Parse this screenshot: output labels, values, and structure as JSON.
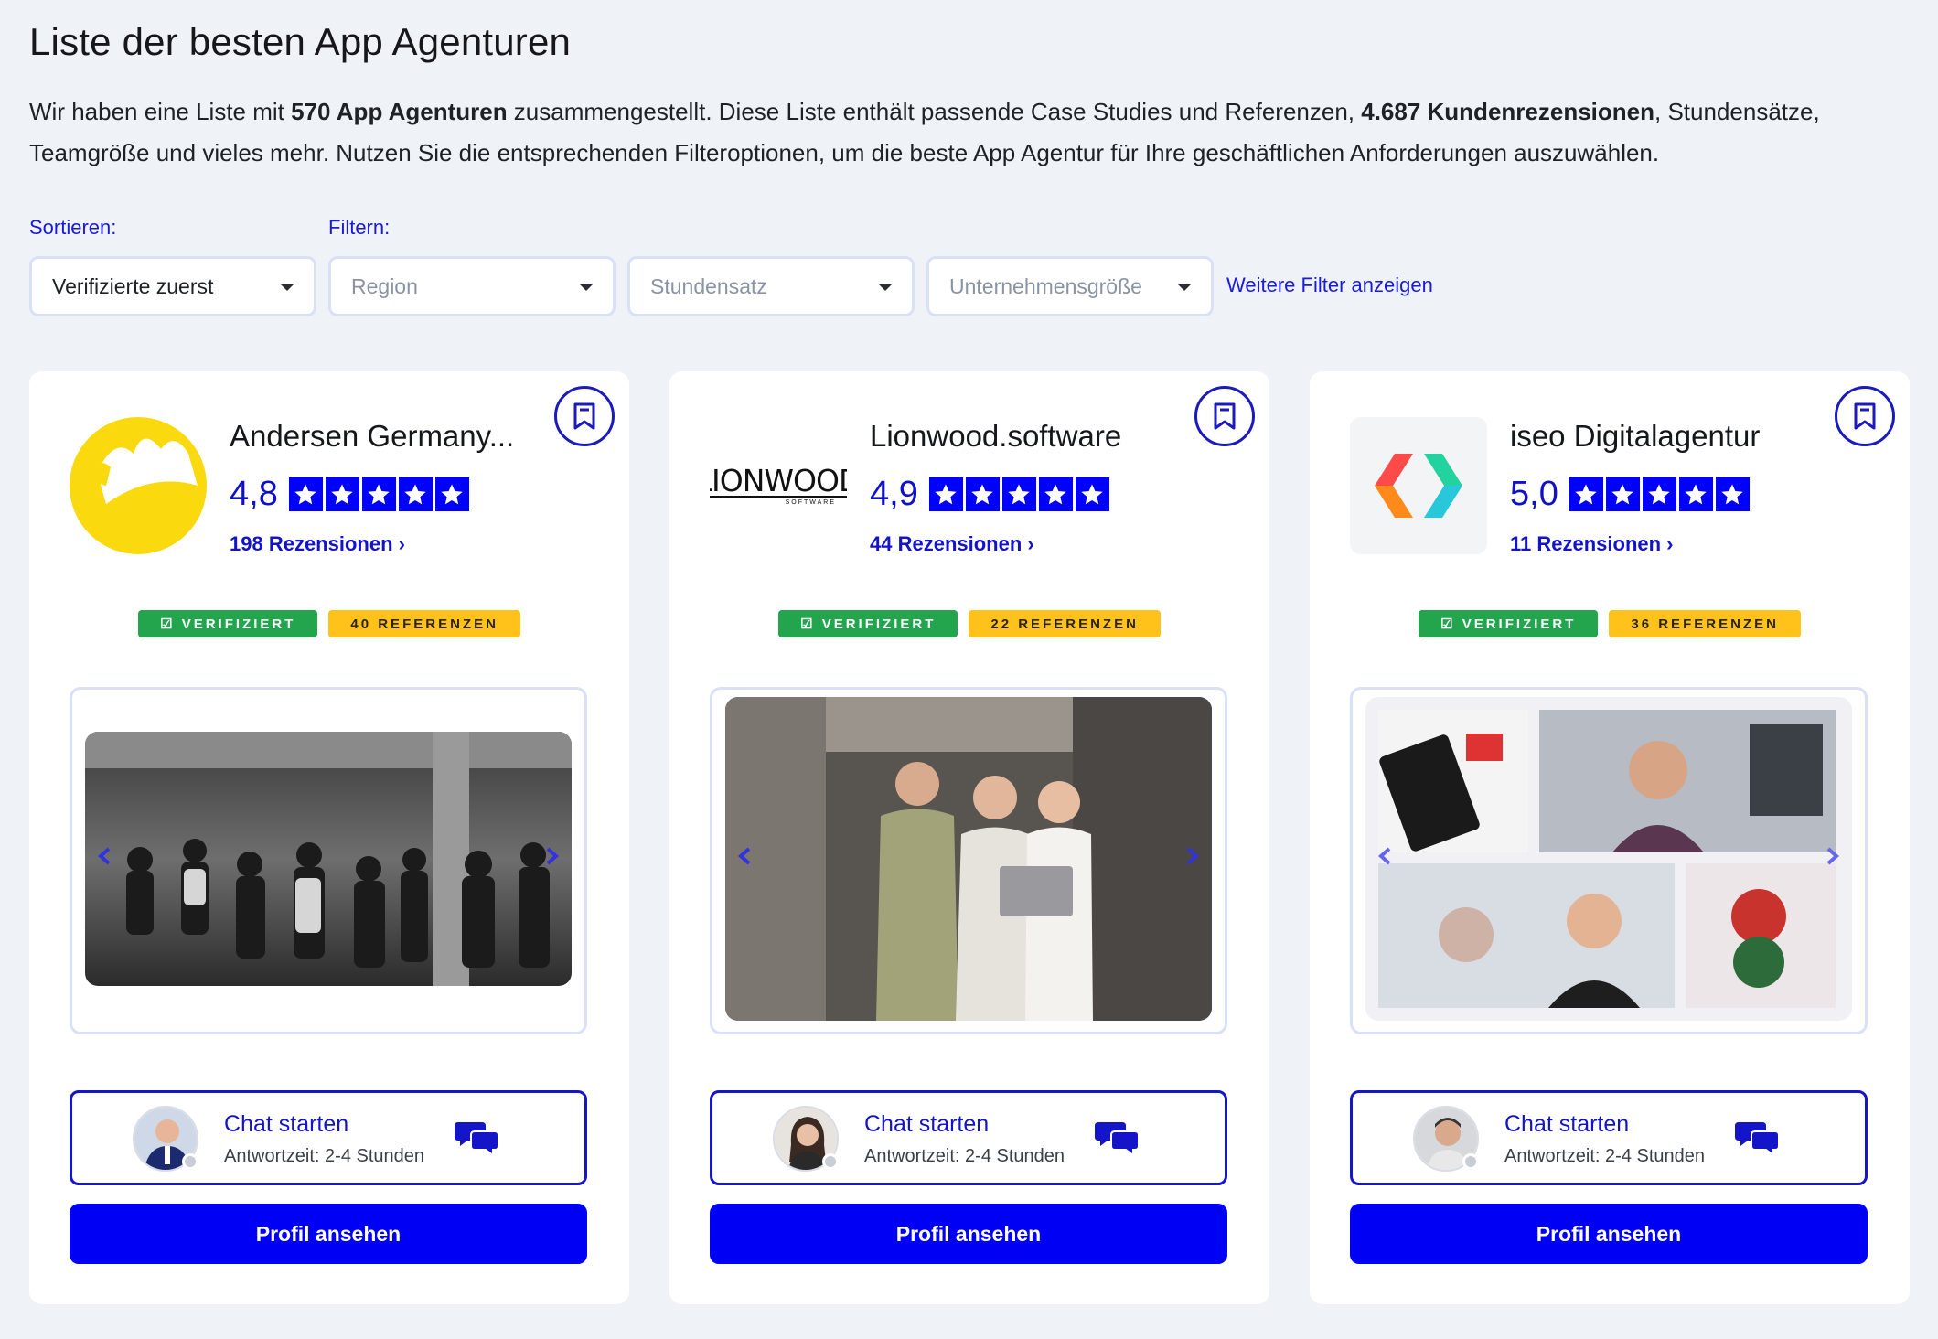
{
  "header": {
    "title": "Liste der besten App Agenturen",
    "intro_p1": "Wir haben eine Liste mit ",
    "intro_b1": "570 App Agenturen",
    "intro_p2": " zusammengestellt. Diese Liste enthält passende Case Studies und Referenzen, ",
    "intro_b2": "4.687 Kundenrezensionen",
    "intro_p3": ", Stundensätze, Teamgröße und vieles mehr. Nutzen Sie die entsprechenden Filteroptionen, um die beste App Agentur für Ihre geschäftlichen Anforderungen auszuwählen."
  },
  "controls": {
    "sort_label": "Sortieren:",
    "filter_label": "Filtern:",
    "sort_value": "Verifizierte zuerst",
    "region_placeholder": "Region",
    "rate_placeholder": "Stundensatz",
    "size_placeholder": "Unternehmensgröße",
    "more_filters": "Weitere Filter anzeigen"
  },
  "colors": {
    "accent": "#0000f5",
    "verified": "#22a54c",
    "references": "#ffc21a",
    "background": "#eff3f8"
  },
  "cards": [
    {
      "name": "Andersen Germany...",
      "rating": "4,8",
      "reviews": "198 Rezensionen ›",
      "verified": "☑ VERIFIZIERT",
      "references": "40 REFERENZEN",
      "chat_title": "Chat starten",
      "chat_sub": "Antwortzeit: 2-4 Stunden",
      "profile_btn": "Profil ansehen"
    },
    {
      "name": "Lionwood.software",
      "rating": "4,9",
      "reviews": "44 Rezensionen ›",
      "verified": "☑ VERIFIZIERT",
      "references": "22 REFERENZEN",
      "chat_title": "Chat starten",
      "chat_sub": "Antwortzeit: 2-4 Stunden",
      "profile_btn": "Profil ansehen",
      "logo_text": "LIONWOOD",
      "logo_sub": "SOFTWARE"
    },
    {
      "name": "iseo Digitalagentur",
      "rating": "5,0",
      "reviews": "11 Rezensionen ›",
      "verified": "☑ VERIFIZIERT",
      "references": "36 REFERENZEN",
      "chat_title": "Chat starten",
      "chat_sub": "Antwortzeit: 2-4 Stunden",
      "profile_btn": "Profil ansehen"
    }
  ]
}
